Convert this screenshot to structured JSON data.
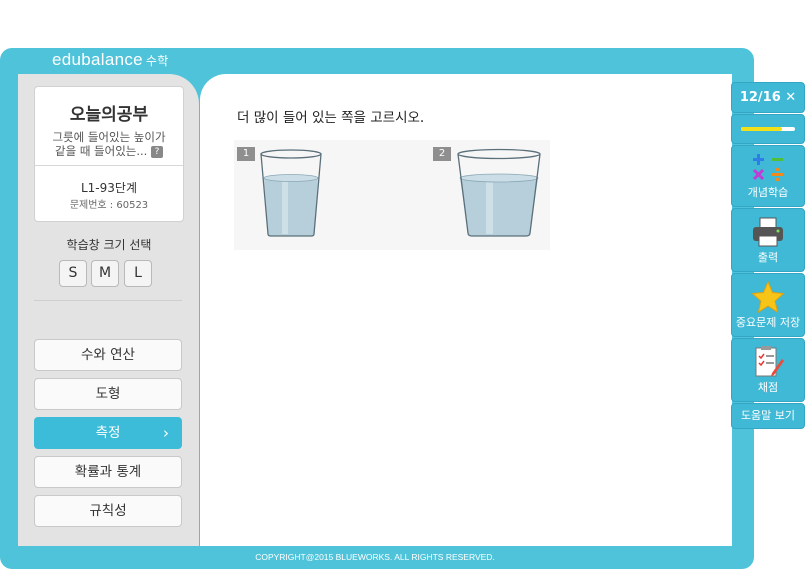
{
  "app": {
    "logo_brand": "edubalance",
    "logo_sub": "수학"
  },
  "card": {
    "title": "오늘의공부",
    "desc_line1": "그릇에 들어있는 높이가",
    "desc_line2": "같을 때 들어있는...",
    "help_icon": "?",
    "step": "L1-93단계",
    "problem_no": "문제번호 : 60523"
  },
  "size": {
    "label": "학습창 크기 선택",
    "options": [
      "S",
      "M",
      "L"
    ]
  },
  "categories": [
    {
      "label": "수와 연산",
      "active": false
    },
    {
      "label": "도형",
      "active": false
    },
    {
      "label": "측정",
      "active": true
    },
    {
      "label": "확률과 통계",
      "active": false
    },
    {
      "label": "규칙성",
      "active": false
    }
  ],
  "question": "더 많이 들어 있는 쪽을 고르시오.",
  "options": [
    "1",
    "2"
  ],
  "right_panel": {
    "progress": "12/16",
    "close_icon": "✕",
    "progress_fraction": 0.75,
    "concept": "개념학습",
    "print": "출력",
    "save": "중요문제 저장",
    "grade": "채점",
    "help": "도움말 보기"
  },
  "footer": "COPYRIGHT@2015 BLUEWORKS. ALL RIGHTS RESERVED.",
  "colors": {
    "frame": "#4ec3da",
    "accent": "#3dbcd9",
    "water": "#b7cfdb"
  }
}
